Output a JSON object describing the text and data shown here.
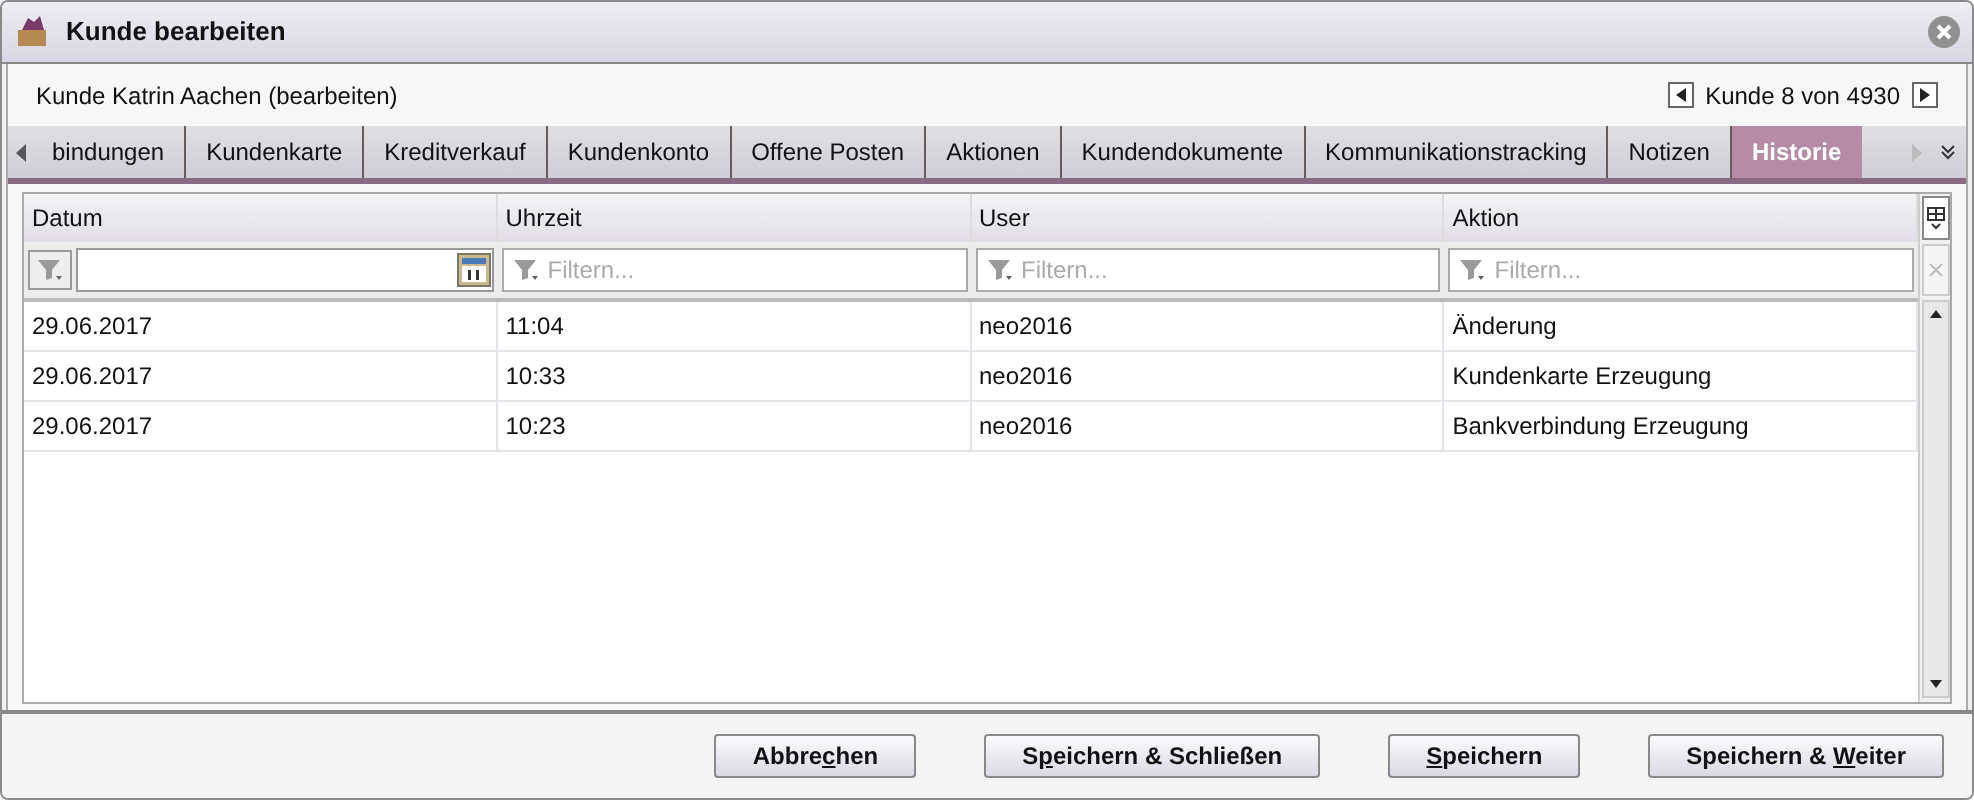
{
  "window": {
    "title": "Kunde bearbeiten"
  },
  "subtitle": "Kunde Katrin Aachen (bearbeiten)",
  "pager": {
    "text": "Kunde 8 von 4930"
  },
  "tabs": [
    {
      "label": "bindungen",
      "selected": false
    },
    {
      "label": "Kundenkarte",
      "selected": false
    },
    {
      "label": "Kreditverkauf",
      "selected": false
    },
    {
      "label": "Kundenkonto",
      "selected": false
    },
    {
      "label": "Offene Posten",
      "selected": false
    },
    {
      "label": "Aktionen",
      "selected": false
    },
    {
      "label": "Kundendokumente",
      "selected": false
    },
    {
      "label": "Kommunikationstracking",
      "selected": false
    },
    {
      "label": "Notizen",
      "selected": false
    },
    {
      "label": "Historie",
      "selected": true
    }
  ],
  "table": {
    "columns": [
      {
        "label": "Datum",
        "filter": {
          "kind": "date"
        }
      },
      {
        "label": "Uhrzeit",
        "filter": {
          "kind": "text",
          "placeholder": "Filtern..."
        }
      },
      {
        "label": "User",
        "filter": {
          "kind": "text",
          "placeholder": "Filtern..."
        }
      },
      {
        "label": "Aktion",
        "filter": {
          "kind": "text",
          "placeholder": "Filtern..."
        }
      }
    ],
    "rows": [
      [
        "29.06.2017",
        "11:04",
        "neo2016",
        "Änderung"
      ],
      [
        "29.06.2017",
        "10:33",
        "neo2016",
        "Kundenkarte Erzeugung"
      ],
      [
        "29.06.2017",
        "10:23",
        "neo2016",
        "Bankverbindung Erzeugung"
      ]
    ]
  },
  "buttons": [
    {
      "before": "Abbre",
      "key": "c",
      "after": "hen"
    },
    {
      "before": "S",
      "key": "p",
      "after": "eichern & Schließen"
    },
    {
      "key": "S",
      "after": "peichern"
    },
    {
      "before": "Speichern & ",
      "key": "W",
      "after": "eiter"
    }
  ]
}
